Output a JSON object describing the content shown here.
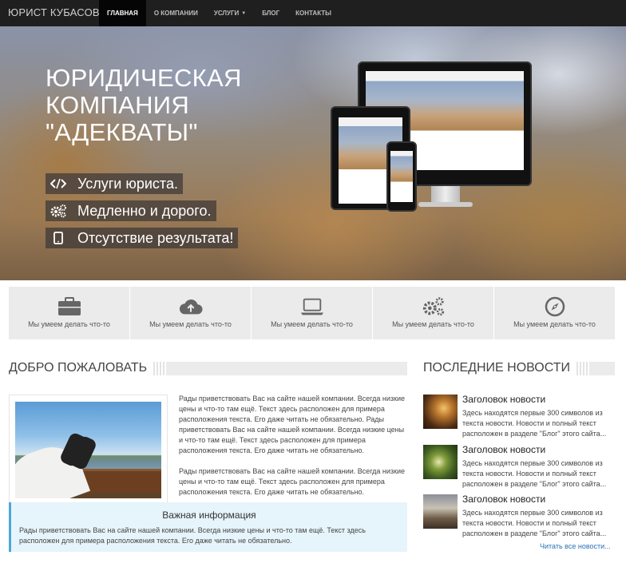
{
  "navbar": {
    "brand": "ЮРИСТ КУБАСОВ",
    "items": [
      {
        "label": "ГЛАВНАЯ",
        "active": true
      },
      {
        "label": "О КОМПАНИИ",
        "active": false
      },
      {
        "label": "УСЛУГИ",
        "active": false,
        "has_dropdown": true
      },
      {
        "label": "БЛОГ",
        "active": false
      },
      {
        "label": "КОНТАКТЫ",
        "active": false
      }
    ]
  },
  "hero": {
    "title_lines": [
      "ЮРИДИЧЕСКАЯ",
      "КОМПАНИЯ",
      "\"АДЕКВАТЫ\""
    ],
    "features": [
      {
        "icon": "code-icon",
        "label": "Услуги юриста."
      },
      {
        "icon": "cogs-icon",
        "label": "Медленно и дорого."
      },
      {
        "icon": "tablet-icon",
        "label": "Отсутствие результата!"
      }
    ]
  },
  "services": [
    {
      "icon": "briefcase-icon",
      "label": "Мы умеем делать что-то"
    },
    {
      "icon": "cloud-upload-icon",
      "label": "Мы умеем делать что-то"
    },
    {
      "icon": "laptop-icon",
      "label": "Мы умеем делать что-то"
    },
    {
      "icon": "cogs-icon",
      "label": "Мы умеем делать что-то"
    },
    {
      "icon": "compass-icon",
      "label": "Мы умеем делать что-то"
    }
  ],
  "welcome": {
    "heading": "ДОБРО ПОЖАЛОВАТЬ",
    "paragraphs": [
      "Рады приветствовать Вас на сайте нашей компании. Всегда низкие цены и что-то там ещё. Текст здесь расположен для примера расположения текста. Его даже читать не обязательно. Рады приветствовать Вас на сайте нашей компании. Всегда низкие цены и что-то там ещё. Текст здесь расположен для примера расположения текста. Его даже читать не обязательно.",
      "Рады приветствовать Вас на сайте нашей компании. Всегда низкие цены и что-то там ещё. Текст здесь расположен для примера расположения текста. Его даже читать не обязательно."
    ],
    "callout_title": "Важная информация",
    "callout_text": "Рады приветствовать Вас на сайте нашей компании. Всегда низкие цены и что-то там ещё. Текст здесь расположен для примера расположения текста. Его даже читать не обязательно."
  },
  "news": {
    "heading": "ПОСЛЕДНИЕ НОВОСТИ",
    "items": [
      {
        "title": "Заголовок новости",
        "text": "Здесь находятся первые 300 символов из текста новости. Новости и полный текст расположен в разделе \"Блог\" этого сайта..."
      },
      {
        "title": "Заголовок новости",
        "text": "Здесь находятся первые 300 символов из текста новости. Новости и полный текст расположен в разделе \"Блог\" этого сайта..."
      },
      {
        "title": "Заголовок новости",
        "text": "Здесь находятся первые 300 символов из текста новости. Новости и полный текст расположен в разделе \"Блог\" этого сайта..."
      }
    ],
    "read_all": "Читать все новости..."
  },
  "colors": {
    "navbar_bg": "#1f1f1f",
    "nav_active_bg": "#050505",
    "services_bg": "#ebebeb",
    "callout_bg": "#e6f4fb",
    "callout_border": "#4aa8d8",
    "link": "#2a74b6"
  }
}
